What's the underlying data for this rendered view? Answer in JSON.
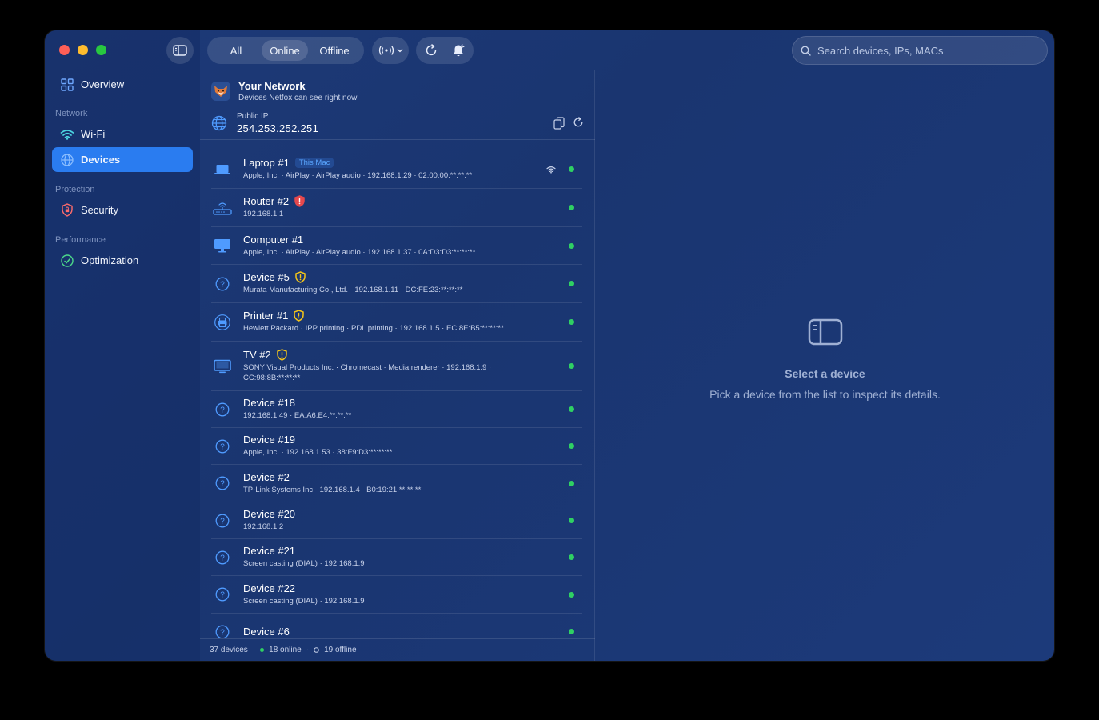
{
  "sidebar": {
    "items": {
      "overview": "Overview",
      "wifi": "Wi-Fi",
      "devices": "Devices",
      "security": "Security",
      "optimization": "Optimization"
    },
    "sections": {
      "network": "Network",
      "protection": "Protection",
      "performance": "Performance"
    }
  },
  "toolbar": {
    "filter_all": "All",
    "filter_online": "Online",
    "filter_offline": "Offline",
    "selected_filter": "Online",
    "search_placeholder": "Search devices, IPs, MACs"
  },
  "network": {
    "title": "Your Network",
    "subtitle": "Devices Netfox can see right now",
    "public_ip_label": "Public IP",
    "public_ip": "254.253.252.251"
  },
  "devices": [
    {
      "name": "Laptop #1",
      "tag": "This Mac",
      "meta": "Apple, Inc. · AirPlay · AirPlay audio · 192.168.1.29 · 02:00:00:**:**:**",
      "icon": "laptop-icon",
      "warn": "",
      "wifi": true
    },
    {
      "name": "Router #2",
      "tag": "",
      "meta": "192.168.1.1",
      "icon": "router-icon",
      "warn": "red",
      "wifi": false
    },
    {
      "name": "Computer #1",
      "tag": "",
      "meta": "Apple, Inc. · AirPlay · AirPlay audio · 192.168.1.37 · 0A:D3:D3:**:**:**",
      "icon": "desktop-icon",
      "warn": "",
      "wifi": false
    },
    {
      "name": "Device #5",
      "tag": "",
      "meta": "Murata Manufacturing Co., Ltd. · 192.168.1.11 · DC:FE:23:**:**:**",
      "icon": "unknown-device-icon",
      "warn": "yellow",
      "wifi": false
    },
    {
      "name": "Printer #1",
      "tag": "",
      "meta": "Hewlett Packard · IPP printing · PDL printing · 192.168.1.5 · EC:8E:B5:**:**:**",
      "icon": "printer-icon",
      "warn": "yellow",
      "wifi": false
    },
    {
      "name": "TV #2",
      "tag": "",
      "meta": "SONY Visual Products Inc. · Chromecast · Media renderer · 192.168.1.9 · CC:98:8B:**:**:**",
      "icon": "tv-icon",
      "warn": "yellow",
      "wifi": false
    },
    {
      "name": "Device #18",
      "tag": "",
      "meta": "192.168.1.49 · EA:A6:E4:**:**:**",
      "icon": "unknown-device-icon",
      "warn": "",
      "wifi": false
    },
    {
      "name": "Device #19",
      "tag": "",
      "meta": "Apple, Inc. · 192.168.1.53 · 38:F9:D3:**:**:**",
      "icon": "unknown-device-icon",
      "warn": "",
      "wifi": false
    },
    {
      "name": "Device #2",
      "tag": "",
      "meta": "TP-Link Systems Inc · 192.168.1.4 · B0:19:21:**:**:**",
      "icon": "unknown-device-icon",
      "warn": "",
      "wifi": false
    },
    {
      "name": "Device #20",
      "tag": "",
      "meta": "192.168.1.2",
      "icon": "unknown-device-icon",
      "warn": "",
      "wifi": false
    },
    {
      "name": "Device #21",
      "tag": "",
      "meta": "Screen casting (DIAL) · 192.168.1.9",
      "icon": "unknown-device-icon",
      "warn": "",
      "wifi": false
    },
    {
      "name": "Device #22",
      "tag": "",
      "meta": "Screen casting (DIAL) · 192.168.1.9",
      "icon": "unknown-device-icon",
      "warn": "",
      "wifi": false
    },
    {
      "name": "Device #6",
      "tag": "",
      "meta": "",
      "icon": "unknown-device-icon",
      "warn": "",
      "wifi": false
    }
  ],
  "footer": {
    "total": "37 devices",
    "online": "18 online",
    "offline": "19 offline"
  },
  "detail": {
    "empty_title": "Select a device",
    "empty_subtitle": "Pick a device from the list to inspect its details."
  },
  "colors": {
    "accent": "#2a7cf0",
    "online": "#2fd063",
    "warn_yellow": "#f5c518",
    "warn_red": "#e5484d"
  }
}
